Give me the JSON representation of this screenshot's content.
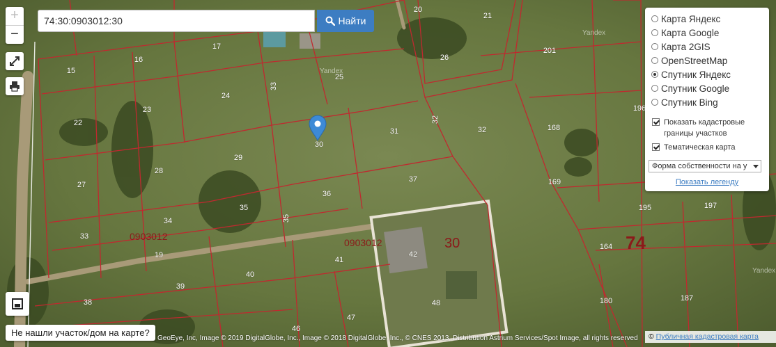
{
  "map": {
    "plots": [
      {
        "label": "20"
      },
      {
        "label": "21"
      },
      {
        "label": "17"
      },
      {
        "label": "201"
      },
      {
        "label": "15"
      },
      {
        "label": "16"
      },
      {
        "label": "26"
      },
      {
        "label": "25"
      },
      {
        "label": "24"
      },
      {
        "label": "23"
      },
      {
        "label": "196"
      },
      {
        "label": "22"
      },
      {
        "label": "31"
      },
      {
        "label": "32"
      },
      {
        "label": "168"
      },
      {
        "label": "30"
      },
      {
        "label": "29"
      },
      {
        "label": "28"
      },
      {
        "label": "27"
      },
      {
        "label": "37"
      },
      {
        "label": "36"
      },
      {
        "label": "169"
      },
      {
        "label": "35"
      },
      {
        "label": "34"
      },
      {
        "label": "195"
      },
      {
        "label": "197"
      },
      {
        "label": "33"
      },
      {
        "label": "19"
      },
      {
        "label": "42"
      },
      {
        "label": "41"
      },
      {
        "label": "164"
      },
      {
        "label": "40"
      },
      {
        "label": "39"
      },
      {
        "label": "38"
      },
      {
        "label": "48"
      },
      {
        "label": "180"
      },
      {
        "label": "187"
      },
      {
        "label": "46"
      },
      {
        "label": "47"
      },
      {
        "label": "33"
      },
      {
        "label": "35"
      },
      {
        "label": "32"
      }
    ],
    "quarter_labels": [
      "0903012",
      "0903012"
    ],
    "selected_plot_label": "30",
    "region_label": "74",
    "watermarks": [
      "Yandex",
      "Yandex",
      "Yandex"
    ]
  },
  "search": {
    "value": "74:30:0903012:30",
    "button_label": "Найти"
  },
  "zoom": {
    "in": "+",
    "out": "−"
  },
  "layers": {
    "options": [
      {
        "label": "Карта Яндекс",
        "selected": false
      },
      {
        "label": "Карта Google",
        "selected": false
      },
      {
        "label": "Карта 2GIS",
        "selected": false
      },
      {
        "label": "OpenStreetMap",
        "selected": false
      },
      {
        "label": "Спутник Яндекс",
        "selected": true
      },
      {
        "label": "Спутник Google",
        "selected": false
      },
      {
        "label": "Спутник Bing",
        "selected": false
      }
    ],
    "checkboxes": [
      {
        "label": "Показать кадастровые границы участков",
        "checked": true
      },
      {
        "label": "Тематическая карта",
        "checked": true
      }
    ],
    "thematic_select": "Форма собственности на у",
    "legend_link": "Показать легенду"
  },
  "bottom": {
    "not_found": "Не нашли участок/дом на карте?",
    "copyright": "GeoEye, Inc, Image © 2019 DigitalGlobe, Inc., Image © 2018 DigitalGlobe, Inc., © CNES 2013, Distribution Astrium Services/Spot Image, all rights reserved",
    "attrib_prefix": "©",
    "attrib_link": "Публичная кадастровая карта"
  },
  "colors": {
    "accent": "#3d7dc2",
    "boundary": "#c0292f",
    "marker": "#3d8ad6"
  }
}
